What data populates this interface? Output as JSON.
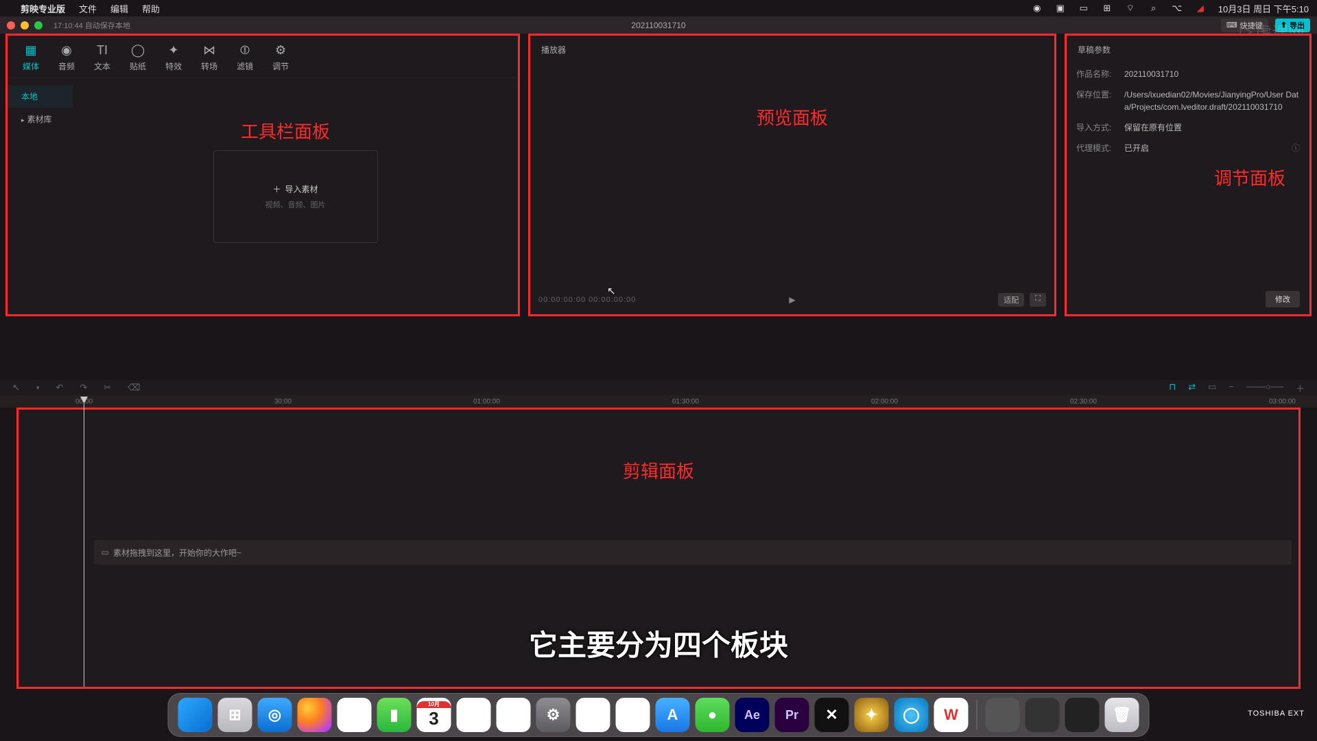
{
  "mac_menu": {
    "app": "剪映专业版",
    "items": [
      "文件",
      "编辑",
      "帮助"
    ],
    "date": "10月3日 周日 下午5:10"
  },
  "titlebar": {
    "autosave": "17:10:44 自动保存本地",
    "project": "202110031710",
    "shortcut_label": "快捷键",
    "export_label": "导出",
    "traffic": {
      "close": "#ff5f57",
      "min": "#febc2e",
      "max": "#28c840"
    }
  },
  "tool_tabs": [
    {
      "id": "media",
      "label": "媒体",
      "glyph": "▦"
    },
    {
      "id": "audio",
      "label": "音频",
      "glyph": "◉"
    },
    {
      "id": "text",
      "label": "文本",
      "glyph": "TI"
    },
    {
      "id": "sticker",
      "label": "贴纸",
      "glyph": "◯"
    },
    {
      "id": "effect",
      "label": "特效",
      "glyph": "✦"
    },
    {
      "id": "transition",
      "label": "转场",
      "glyph": "⋈"
    },
    {
      "id": "filter",
      "label": "滤镜",
      "glyph": "⦷"
    },
    {
      "id": "adjust",
      "label": "调节",
      "glyph": "⚙"
    }
  ],
  "left_sidebar": {
    "local": "本地",
    "library": "素材库"
  },
  "import_box": {
    "title": "导入素材",
    "sub": "视频、音频、图片"
  },
  "annotations": {
    "toolbox": "工具栏面板",
    "preview": "预览面板",
    "props": "调节面板",
    "timeline": "剪辑面板"
  },
  "preview": {
    "header": "播放器",
    "timecode": "00:00:00:00  00:00:00:00",
    "ratio": "适配"
  },
  "props": {
    "header": "草稿参数",
    "rows": {
      "name_k": "作品名称:",
      "name_v": "202110031710",
      "path_k": "保存位置:",
      "path_v": "/Users/ixuedian02/Movies/JianyingPro/User Data/Projects/com.lveditor.draft/202110031710",
      "import_k": "导入方式:",
      "import_v": "保留在原有位置",
      "proxy_k": "代理模式:",
      "proxy_v": "已开启"
    },
    "modify": "修改"
  },
  "timeline": {
    "ticks": [
      "00:00",
      "30:00",
      "01:00:00",
      "01:30:00",
      "02:00:00",
      "02:30:00",
      "03:00:00"
    ],
    "placeholder": "素材拖拽到这里，开始你的大作吧~"
  },
  "subtitle": "它主要分为四个板块",
  "disk_label": "TOSHIBA EXT",
  "watermark": "虎课网",
  "dock": [
    {
      "name": "finder",
      "bg": "linear-gradient(135deg,#2aa8ff,#0a6ed1)",
      "txt": ""
    },
    {
      "name": "launchpad",
      "bg": "linear-gradient(#d9d9de,#b7b7bd)",
      "txt": "⊞"
    },
    {
      "name": "safari",
      "bg": "linear-gradient(#3fa9ff,#0a6ed1)",
      "txt": "◎"
    },
    {
      "name": "firefox",
      "bg": "radial-gradient(circle at 30% 30%,#ffce3a,#ff7f1f 40%,#b239ff 90%)",
      "txt": ""
    },
    {
      "name": "photos",
      "bg": "#fff",
      "txt": "✿"
    },
    {
      "name": "facetime",
      "bg": "linear-gradient(#6dde5a,#28b83c)",
      "txt": "▮"
    },
    {
      "name": "calendar",
      "bg": "#fff",
      "txt": "3"
    },
    {
      "name": "notes",
      "bg": "#fff",
      "txt": ""
    },
    {
      "name": "reminders",
      "bg": "#fff",
      "txt": "•"
    },
    {
      "name": "settings",
      "bg": "linear-gradient(#8d8d92,#5b5b60)",
      "txt": "⚙"
    },
    {
      "name": "numbers",
      "bg": "#fff",
      "txt": "▮"
    },
    {
      "name": "pages",
      "bg": "#fff",
      "txt": "✎"
    },
    {
      "name": "appstore",
      "bg": "linear-gradient(#46b1ff,#1877e6)",
      "txt": "A"
    },
    {
      "name": "wechat",
      "bg": "linear-gradient(#5edc5e,#2eb82e)",
      "txt": "●"
    },
    {
      "name": "aftereffects",
      "bg": "#00005b",
      "txt": "Ae"
    },
    {
      "name": "premiere",
      "bg": "#2a003f",
      "txt": "Pr"
    },
    {
      "name": "capcut",
      "bg": "#111",
      "txt": "✕"
    },
    {
      "name": "finalcut",
      "bg": "radial-gradient(circle,#ffd24a,#8a5a10)",
      "txt": "✦"
    },
    {
      "name": "chrome-like",
      "bg": "radial-gradient(circle,#4fc3f7,#0277bd)",
      "txt": "◯"
    },
    {
      "name": "wps",
      "bg": "#fff",
      "txt": "W"
    }
  ]
}
